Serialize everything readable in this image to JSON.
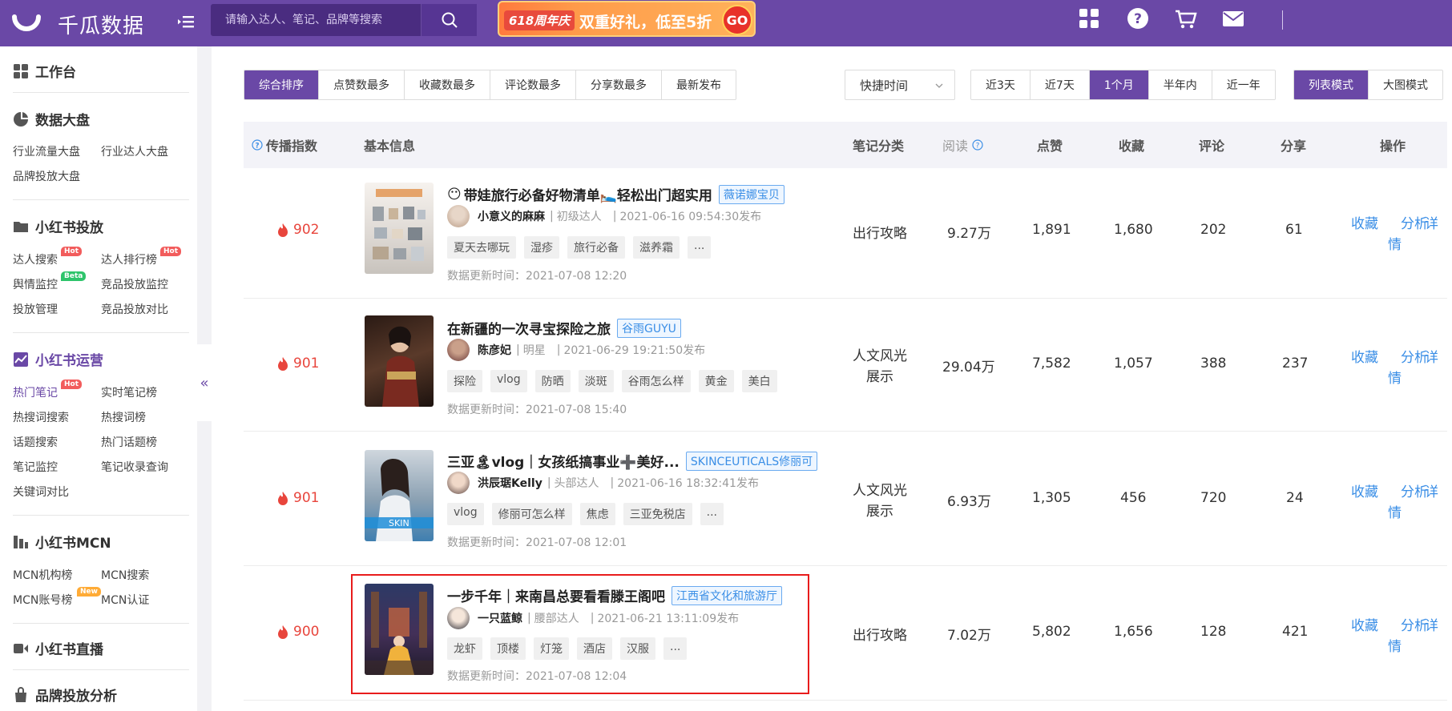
{
  "header": {
    "brand": "千瓜数据",
    "search_placeholder": "请输入达人、笔记、品牌等搜索",
    "promo": {
      "badge": "618周年庆",
      "text": "双重好礼，低至5折",
      "go": "GO"
    }
  },
  "sidebar": {
    "workbench": "工作台",
    "sections": [
      {
        "title": "数据大盘",
        "items": [
          "行业流量大盘",
          "行业达人大盘",
          "品牌投放大盘"
        ]
      },
      {
        "title": "小红书投放",
        "items": [
          "达人搜索",
          "达人排行榜",
          "舆情监控",
          "竞品投放监控",
          "投放管理",
          "竞品投放对比"
        ]
      },
      {
        "title": "小红书运营",
        "items": [
          "热门笔记",
          "实时笔记榜",
          "热搜词搜索",
          "热搜词榜",
          "话题搜索",
          "热门话题榜",
          "笔记监控",
          "笔记收录查询",
          "关键词对比"
        ]
      },
      {
        "title": "小红书MCN",
        "items": [
          "MCN机构榜",
          "MCN搜索",
          "MCN账号榜",
          "MCN认证"
        ]
      },
      {
        "title": "小红书直播",
        "items": []
      },
      {
        "title": "品牌投放分析",
        "items": []
      }
    ],
    "badges": {
      "hot": "Hot",
      "beta": "Beta",
      "new": "New"
    },
    "collapse": "«"
  },
  "filters": {
    "sort": [
      "综合排序",
      "点赞数最多",
      "收藏数最多",
      "评论数最多",
      "分享数最多",
      "最新发布"
    ],
    "sort_selected": "综合排序",
    "quick_time": "快捷时间",
    "ranges": [
      "近3天",
      "近7天",
      "1个月",
      "半年内",
      "近一年"
    ],
    "range_selected": "1个月",
    "modes": [
      "列表模式",
      "大图模式"
    ],
    "mode_selected": "列表模式"
  },
  "table": {
    "headers": [
      "传播指数",
      "基本信息",
      "笔记分类",
      "阅读",
      "点赞",
      "收藏",
      "评论",
      "分享",
      "操作"
    ],
    "actions": [
      "收藏",
      "分析",
      "详",
      "情"
    ],
    "updated_prefix": "数据更新时间：",
    "rows": [
      {
        "score": "902",
        "title": "带娃旅行必备好物清单🛌轻松出门超实用",
        "brand": "薇诺娜宝贝",
        "author": "小意义的麻麻",
        "level": "初级达人",
        "published": "2021-06-16 09:54:30发布",
        "tags": [
          "夏天去哪玩",
          "湿疹",
          "旅行必备",
          "滋养霜",
          "..."
        ],
        "updated": "2021-07-08 12:20",
        "category": "出行攻略",
        "reads": "9.27万",
        "likes": "1,891",
        "favs": "1,680",
        "comments": "202",
        "shares": "61"
      },
      {
        "score": "901",
        "title": "在新疆的一次寻宝探险之旅",
        "brand": "谷雨GUYU",
        "author": "陈彦妃",
        "level": "明星",
        "published": "2021-06-29 19:21:50发布",
        "tags": [
          "探险",
          "vlog",
          "防晒",
          "淡斑",
          "谷雨怎么样",
          "黄金",
          "美白"
        ],
        "updated": "2021-07-08 15:40",
        "category": "人文风光展示",
        "reads": "29.04万",
        "likes": "7,582",
        "favs": "1,057",
        "comments": "388",
        "shares": "237"
      },
      {
        "score": "901",
        "title": "三亚🏝vlog｜女孩纸搞事业➕美好...",
        "brand": "SKINCEUTICALS修丽可",
        "author": "洪辰琚Kelly",
        "level": "头部达人",
        "published": "2021-06-16 18:32:41发布",
        "tags": [
          "vlog",
          "修丽可怎么样",
          "焦虑",
          "三亚免税店",
          "..."
        ],
        "updated": "2021-07-08 12:01",
        "category": "人文风光展示",
        "reads": "6.93万",
        "likes": "1,305",
        "favs": "456",
        "comments": "720",
        "shares": "24"
      },
      {
        "score": "900",
        "title": "一步千年｜来南昌总要看看滕王阁吧",
        "brand": "江西省文化和旅游厅",
        "author": "一只蓝鲸",
        "level": "腰部达人",
        "published": "2021-06-21 13:11:09发布",
        "tags": [
          "龙虾",
          "顶楼",
          "灯笼",
          "酒店",
          "汉服",
          "..."
        ],
        "updated": "2021-07-08 12:04",
        "category": "出行攻略",
        "reads": "7.02万",
        "likes": "5,802",
        "favs": "1,656",
        "comments": "128",
        "shares": "421"
      }
    ]
  },
  "colors": {
    "brand": "#6a48a6",
    "fire": "#e8453c",
    "link": "#3a8ee6",
    "highlight": "#e81c1c"
  }
}
